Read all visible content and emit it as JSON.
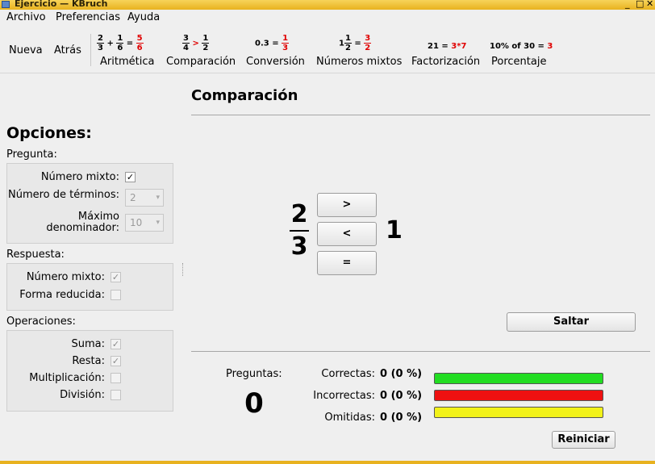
{
  "window": {
    "title": "Ejercicio — KBruch",
    "buttons": [
      "_",
      "□",
      "✕"
    ]
  },
  "menubar": [
    {
      "label": "Archivo"
    },
    {
      "label": "Preferencias"
    },
    {
      "label": "Ayuda"
    }
  ],
  "toolbar": {
    "new_label": "Nueva",
    "back_label": "Atrás",
    "modes": [
      {
        "label": "Aritmética",
        "icon": "arithmetic-icon"
      },
      {
        "label": "Comparación",
        "icon": "comparison-icon"
      },
      {
        "label": "Conversión",
        "icon": "conversion-icon"
      },
      {
        "label": "Números mixtos",
        "icon": "mixed-numbers-icon"
      },
      {
        "label": "Factorización",
        "icon": "factorization-icon"
      },
      {
        "label": "Porcentaje",
        "icon": "percentage-icon"
      }
    ],
    "icons": {
      "arith": {
        "a_num": "2",
        "a_den": "3",
        "plus": "+",
        "b_num": "1",
        "b_den": "6",
        "eq": "=",
        "r_num": "5",
        "r_den": "6"
      },
      "comp": {
        "a_num": "3",
        "a_den": "4",
        "op": ">",
        "b_num": "1",
        "b_den": "2"
      },
      "conv": {
        "dec": "0.3",
        "eq": "=",
        "r_num": "1",
        "r_den": "3"
      },
      "mixed": {
        "whole": "1",
        "a_num": "1",
        "a_den": "2",
        "eq": "=",
        "r_num": "3",
        "r_den": "2"
      },
      "fact": {
        "text": "21 =",
        "result": "3*7"
      },
      "pct": {
        "text": "10% of 30 =",
        "result": "3"
      }
    }
  },
  "options": {
    "title": "Opciones:",
    "pregunta": {
      "heading": "Pregunta:",
      "mixed_label": "Número mixto:",
      "mixed_checked": "✓",
      "terms_label": "Número de términos:",
      "terms_value": "2",
      "max_den_label_1": "Máximo",
      "max_den_label_2": "denominador:",
      "max_den_value": "10"
    },
    "respuesta": {
      "heading": "Respuesta:",
      "mixed_label": "Número mixto:",
      "mixed_checked": "✓",
      "reduced_label": "Forma reducida:"
    },
    "operaciones": {
      "heading": "Operaciones:",
      "sum_label": "Suma:",
      "sum_checked": "✓",
      "sub_label": "Resta:",
      "sub_checked": "✓",
      "mul_label": "Multiplicación:",
      "div_label": "División:"
    }
  },
  "exercise": {
    "title": "Comparación",
    "left_num": "2",
    "left_den": "3",
    "right_value": "1",
    "buttons": [
      ">",
      "<",
      "="
    ],
    "skip_label": "Saltar",
    "reset_label": "Reiniciar"
  },
  "stats": {
    "questions_label": "Preguntas:",
    "questions_count": "0",
    "correct_label": "Correctas:",
    "correct_value": "0 (0 %)",
    "incorrect_label": "Incorrectas:",
    "incorrect_value": "0 (0 %)",
    "skipped_label": "Omitidas:",
    "skipped_value": "0 (0 %)",
    "colors": {
      "correct": "#22dd22",
      "incorrect": "#ee1111",
      "skipped": "#f2f21a"
    }
  }
}
